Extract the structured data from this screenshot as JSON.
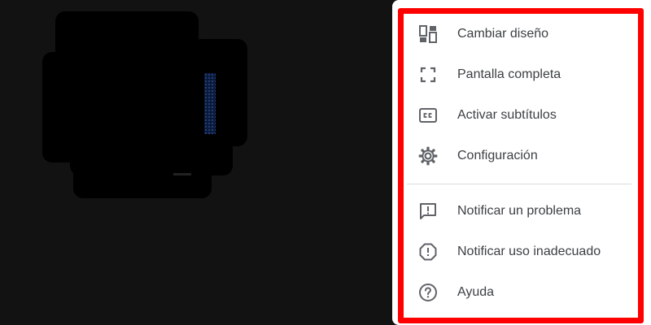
{
  "menu": {
    "items": [
      {
        "label": "Cambiar diseño",
        "icon": "layout-icon"
      },
      {
        "label": "Pantalla completa",
        "icon": "fullscreen-icon"
      },
      {
        "label": "Activar subtítulos",
        "icon": "closed-captions-icon"
      },
      {
        "label": "Configuración",
        "icon": "gear-icon"
      },
      {
        "label": "Notificar un problema",
        "icon": "report-problem-icon"
      },
      {
        "label": "Notificar uso inadecuado",
        "icon": "report-abuse-icon"
      },
      {
        "label": "Ayuda",
        "icon": "help-icon"
      }
    ]
  },
  "colors": {
    "background": "#121212",
    "menu_background": "#ffffff",
    "highlight_border": "#ff0000",
    "icon": "#5f6368",
    "text": "#3c4043"
  }
}
